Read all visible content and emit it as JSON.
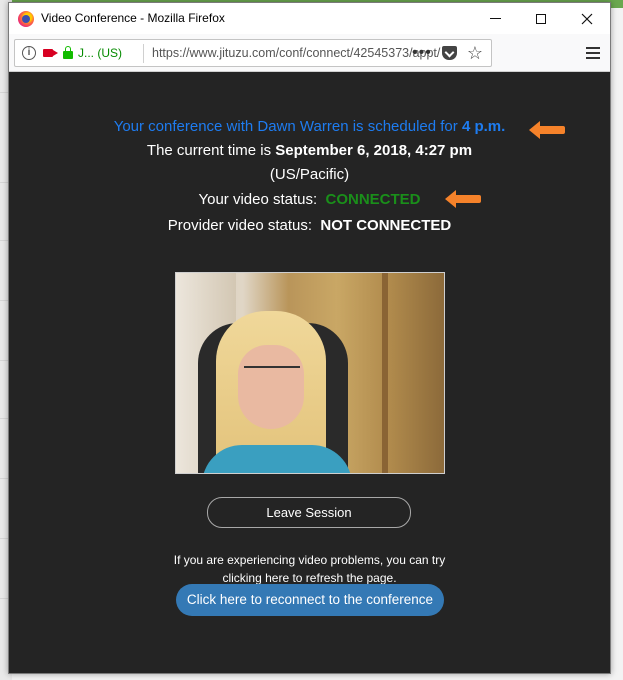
{
  "window": {
    "title": "Video Conference - Mozilla Firefox"
  },
  "navbar": {
    "site_identity": "J... (US)",
    "url": "https://www.jituzu.com/conf/connect/42545373/appt/"
  },
  "conference": {
    "schedule_prefix": "Your conference with Dawn Warren is scheduled for ",
    "schedule_time": "4 p.m.",
    "current_time_prefix": "The current time is ",
    "current_time_value": "September 6, 2018, 4:27 pm",
    "timezone": "(US/Pacific)",
    "your_status_label": "Your video status:",
    "your_status_value": "CONNECTED",
    "provider_status_label": "Provider video status:",
    "provider_status_value": "NOT CONNECTED"
  },
  "actions": {
    "leave_label": "Leave Session",
    "help_line1": "If you are experiencing video problems, you can try",
    "help_line2": "clicking here to refresh the page.",
    "reconnect_label": "Click here to reconnect to the conference"
  },
  "colors": {
    "content_bg": "#242424",
    "accent_blue": "#1e7cf0",
    "status_green": "#1a8f1a",
    "arrow_orange": "#f5822a",
    "button_blue": "#3479b5"
  },
  "icons": [
    "firefox-logo-icon",
    "info-icon",
    "camera-icon",
    "lock-icon",
    "more-dots-icon",
    "pocket-icon",
    "bookmark-star-icon",
    "hamburger-menu-icon",
    "minimize-icon",
    "maximize-icon",
    "close-icon",
    "arrow-left-icon"
  ]
}
